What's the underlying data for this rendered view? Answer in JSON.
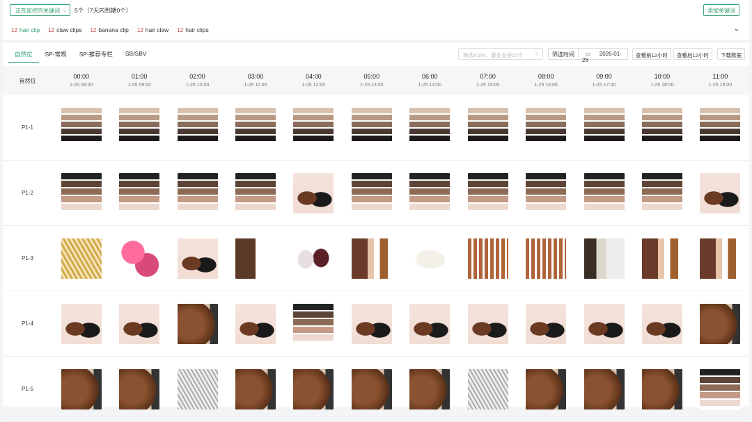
{
  "top": {
    "monitor_select": "正在监控的关键词",
    "count_text": "5个（7天内到期0个）",
    "add_keyword": "添加关键词",
    "keywords": [
      {
        "rank": "12",
        "label": "hair clip"
      },
      {
        "rank": "12",
        "label": "claw clips"
      },
      {
        "rank": "12",
        "label": "banana clip"
      },
      {
        "rank": "12",
        "label": "hair claw"
      },
      {
        "rank": "12",
        "label": "hair clips"
      }
    ]
  },
  "tabs": [
    "自然位",
    "SP-常规",
    "SP-推荐专栏",
    "SB/SBV"
  ],
  "toolbar": {
    "search_placeholder": "筛选ASIN，最多支持10个",
    "time_label": "筛选时间",
    "date": "2026-01-26",
    "prev": "查看前12小时",
    "next": "查看后12小时",
    "download": "下载数据"
  },
  "table": {
    "corner": "自然位",
    "columns": [
      {
        "t": "00:00",
        "d": "1-25 08:00"
      },
      {
        "t": "01:00",
        "d": "1-25 09:00"
      },
      {
        "t": "02:00",
        "d": "1-25 10:00"
      },
      {
        "t": "03:00",
        "d": "1-25 11:00"
      },
      {
        "t": "04:00",
        "d": "1-25 12:00"
      },
      {
        "t": "05:00",
        "d": "1-25 13:00"
      },
      {
        "t": "06:00",
        "d": "1-25 14:00"
      },
      {
        "t": "07:00",
        "d": "1-25 15:00"
      },
      {
        "t": "08:00",
        "d": "1-25 16:00"
      },
      {
        "t": "09:00",
        "d": "1-25 17:00"
      },
      {
        "t": "10:00",
        "d": "1-25 18:00"
      },
      {
        "t": "11:00",
        "d": "1-25 19:00"
      }
    ],
    "rows": [
      {
        "label": "P1-1",
        "cells": [
          "claw-stack",
          "claw-stack",
          "claw-stack",
          "claw-stack",
          "claw-stack",
          "claw-stack",
          "claw-stack",
          "claw-stack",
          "claw-stack",
          "claw-stack",
          "claw-stack",
          "claw-stack"
        ]
      },
      {
        "label": "P1-2",
        "cells": [
          "claw-stack-dark",
          "claw-stack-dark",
          "claw-stack-dark",
          "claw-stack-dark",
          "kitsch",
          "claw-stack-dark",
          "claw-stack-dark",
          "claw-stack-dark",
          "claw-stack-dark",
          "claw-stack-dark",
          "claw-stack-dark",
          "kitsch"
        ]
      },
      {
        "label": "P1-3",
        "cells": [
          "gold-clips",
          "pink-claws",
          "kitsch",
          "model-hair",
          "pearl-claws",
          "model-bear",
          "white-claw",
          "bear-clips",
          "bear-clips",
          "model-side",
          "model-bear",
          "model-bear"
        ]
      },
      {
        "label": "P1-4",
        "cells": [
          "kitsch",
          "kitsch",
          "model-curls",
          "kitsch",
          "claw-stack-dark",
          "kitsch",
          "kitsch",
          "kitsch",
          "kitsch",
          "kitsch",
          "kitsch",
          "model-curls"
        ]
      },
      {
        "label": "P1-5",
        "cells": [
          "model-curls",
          "model-curls",
          "silver-clips",
          "model-curls",
          "model-curls",
          "model-curls",
          "model-curls",
          "silver-clips",
          "model-curls",
          "model-curls",
          "model-curls",
          "claw-stack-dark"
        ]
      }
    ]
  }
}
